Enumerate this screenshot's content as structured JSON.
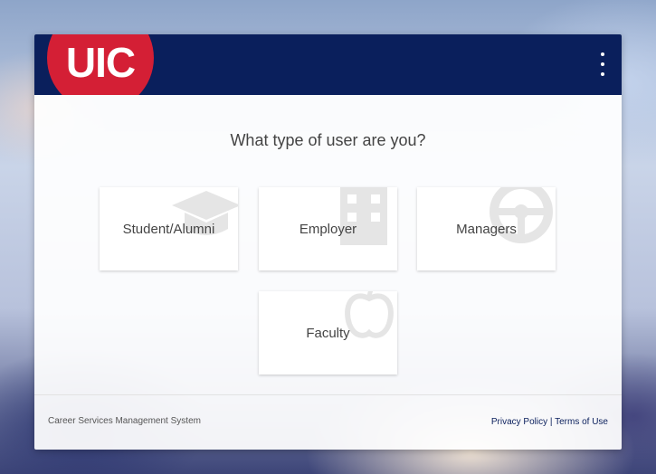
{
  "header": {
    "logo_text": "UIC",
    "menu_icon": "more-vert-icon"
  },
  "main": {
    "question": "What type of user are you?",
    "tiles": [
      {
        "label": "Student/Alumni",
        "icon": "graduation-cap-icon"
      },
      {
        "label": "Employer",
        "icon": "building-icon"
      },
      {
        "label": "Managers",
        "icon": "steering-wheel-icon"
      },
      {
        "label": "Faculty",
        "icon": "apple-icon"
      }
    ]
  },
  "footer": {
    "system_name": "Career Services Management System",
    "privacy_label": "Privacy Policy",
    "separator": "|",
    "terms_label": "Terms of Use"
  },
  "colors": {
    "header_bg": "#0a1f5c",
    "logo_red": "#d41f35"
  }
}
